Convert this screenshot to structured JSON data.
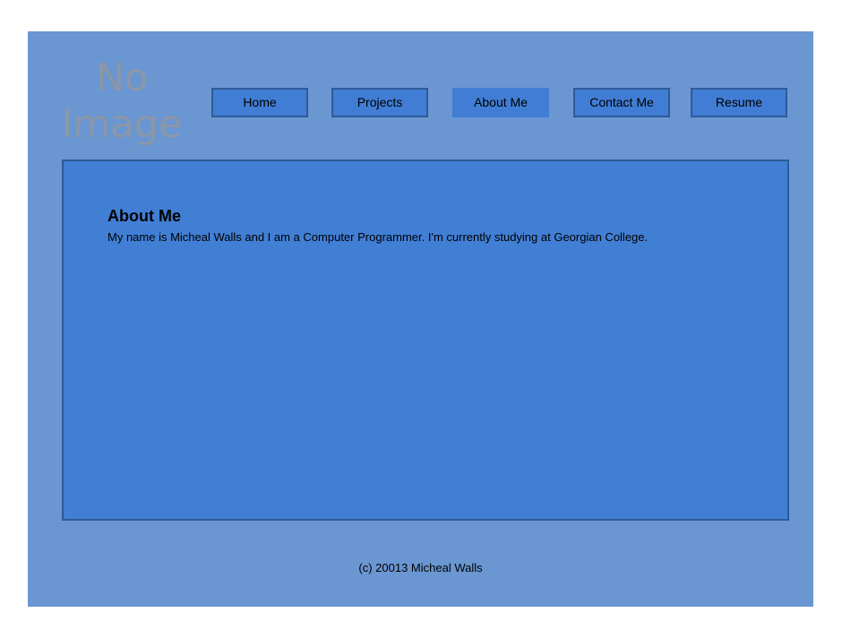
{
  "logo": {
    "line1": "No",
    "line2": "Image"
  },
  "nav": {
    "items": [
      {
        "label": "Home"
      },
      {
        "label": "Projects"
      },
      {
        "label": "About Me"
      },
      {
        "label": "Contact Me"
      },
      {
        "label": "Resume"
      }
    ],
    "active": "About Me"
  },
  "main": {
    "heading": "About Me",
    "paragraph": "My name is Micheal Walls and I am a Computer Programmer. I'm currently studying at Georgian College."
  },
  "footer": {
    "text": "(c) 20013 Micheal Walls"
  },
  "colors": {
    "page_bg": "#6a96d2",
    "content_bg": "#417fd5",
    "border": "#2f5a96",
    "logo_text": "#8b97a8"
  }
}
